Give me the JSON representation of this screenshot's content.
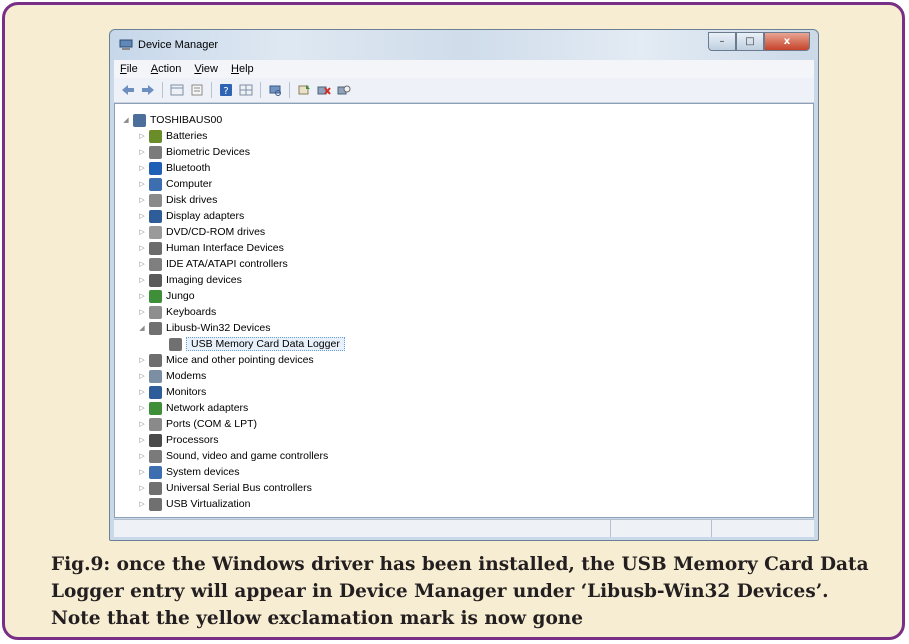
{
  "window": {
    "title": "Device Manager",
    "buttons": {
      "minimize": "–",
      "maximize": "□",
      "close": "x"
    }
  },
  "menu": [
    "File",
    "Action",
    "View",
    "Help"
  ],
  "menu_access_keys": [
    "F",
    "A",
    "V",
    "H"
  ],
  "toolbar_icons": [
    "back-icon",
    "forward-icon",
    "properties-grid-icon",
    "properties-icon",
    "help-icon",
    "view-grid-icon",
    "scan-hardware-icon",
    "update-driver-icon",
    "uninstall-icon",
    "disable-icon"
  ],
  "tree": {
    "root": "TOSHIBAUS00",
    "categories": [
      {
        "label": "Batteries",
        "icon_color": "#6a8d2a"
      },
      {
        "label": "Biometric Devices",
        "icon_color": "#7b7b7b"
      },
      {
        "label": "Bluetooth",
        "icon_color": "#1f5fb5"
      },
      {
        "label": "Computer",
        "icon_color": "#3d6fb0"
      },
      {
        "label": "Disk drives",
        "icon_color": "#8a8a8a"
      },
      {
        "label": "Display adapters",
        "icon_color": "#2f5d9a"
      },
      {
        "label": "DVD/CD-ROM drives",
        "icon_color": "#9a9a9a"
      },
      {
        "label": "Human Interface Devices",
        "icon_color": "#6b6b6b"
      },
      {
        "label": "IDE ATA/ATAPI controllers",
        "icon_color": "#7f7f7f"
      },
      {
        "label": "Imaging devices",
        "icon_color": "#5a5a5a"
      },
      {
        "label": "Jungo",
        "icon_color": "#3f8f3a"
      },
      {
        "label": "Keyboards",
        "icon_color": "#8e8e8e"
      },
      {
        "label": "Libusb-Win32 Devices",
        "icon_color": "#707070",
        "expanded": true,
        "children": [
          {
            "label": "USB Memory Card Data Logger",
            "icon_color": "#707070",
            "selected": true
          }
        ]
      },
      {
        "label": "Mice and other pointing devices",
        "icon_color": "#6e6e6e"
      },
      {
        "label": "Modems",
        "icon_color": "#7c8ea3"
      },
      {
        "label": "Monitors",
        "icon_color": "#2f5d9a"
      },
      {
        "label": "Network adapters",
        "icon_color": "#3f8f3a"
      },
      {
        "label": "Ports (COM & LPT)",
        "icon_color": "#8a8a8a"
      },
      {
        "label": "Processors",
        "icon_color": "#4a4a4a"
      },
      {
        "label": "Sound, video and game controllers",
        "icon_color": "#7a7a7a"
      },
      {
        "label": "System devices",
        "icon_color": "#3d6fb0"
      },
      {
        "label": "Universal Serial Bus controllers",
        "icon_color": "#707070"
      },
      {
        "label": "USB Virtualization",
        "icon_color": "#707070"
      }
    ]
  },
  "caption": "Fig.9: once the Windows driver has been installed, the USB Memory Card Data Logger entry will appear in Device Manager under ‘Libusb-Win32 Devices’. Note that the yellow exclamation mark is now gone"
}
